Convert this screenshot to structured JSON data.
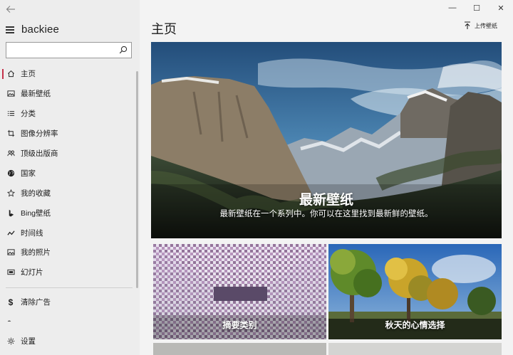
{
  "app": {
    "title": "backiee"
  },
  "search": {
    "placeholder": "",
    "value": ""
  },
  "nav": {
    "items": [
      {
        "label": "主页",
        "icon": "home-icon",
        "active": true
      },
      {
        "label": "最新壁纸",
        "icon": "image-icon"
      },
      {
        "label": "分类",
        "icon": "list-icon"
      },
      {
        "label": "图像分辨率",
        "icon": "crop-icon"
      },
      {
        "label": "顶级出版商",
        "icon": "people-icon"
      },
      {
        "label": "国家",
        "icon": "globe-icon"
      },
      {
        "label": "我的收藏",
        "icon": "star-icon"
      },
      {
        "label": "Bing壁纸",
        "icon": "bing-icon"
      },
      {
        "label": "时间线",
        "icon": "timeline-icon"
      },
      {
        "label": "我的照片",
        "icon": "photo-icon"
      },
      {
        "label": "幻灯片",
        "icon": "slideshow-icon"
      }
    ],
    "secondary": [
      {
        "label": "清除广告",
        "icon": "dollar-icon"
      }
    ],
    "bottom": [
      {
        "label": "设置",
        "icon": "gear-icon"
      }
    ]
  },
  "window": {
    "minimize": "—",
    "maximize": "☐",
    "close": "✕"
  },
  "main": {
    "title": "主页",
    "upload_label": "上传壁纸",
    "hero": {
      "title": "最新壁纸",
      "subtitle": "最新壁纸在一个系列中。你可以在这里找到最新鲜的壁纸。"
    },
    "tiles": [
      {
        "label": "摘要类别"
      },
      {
        "label": "秋天的心情选择"
      }
    ]
  }
}
